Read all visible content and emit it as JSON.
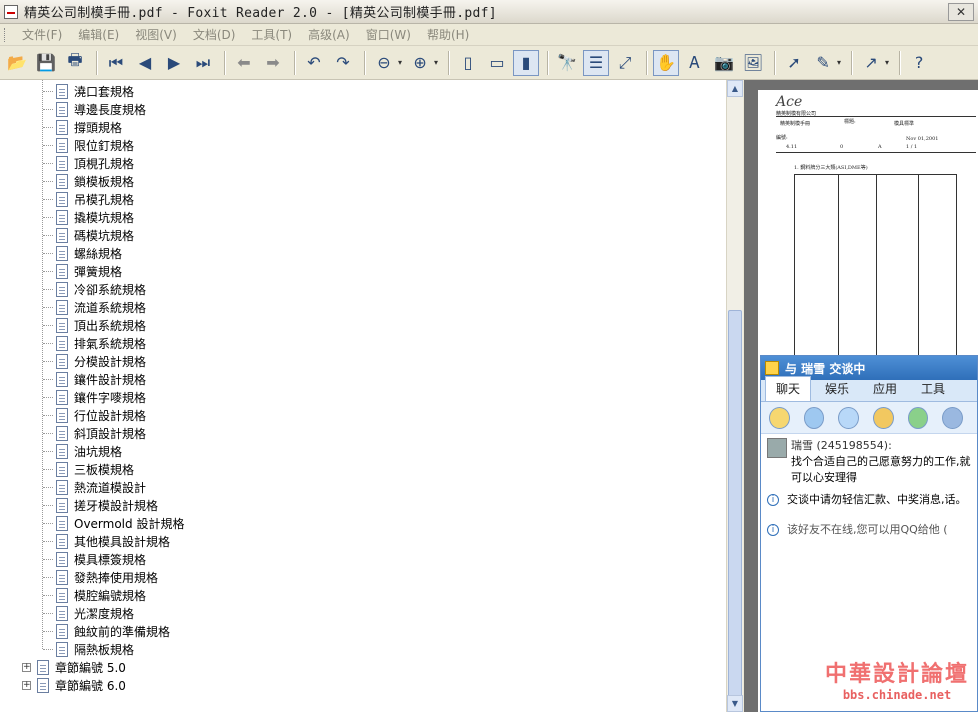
{
  "window": {
    "title": "精英公司制模手冊.pdf - Foxit Reader 2.0 - [精英公司制模手冊.pdf]",
    "close_glyph": "✕"
  },
  "menubar": {
    "items": [
      "文件(F)",
      "编辑(E)",
      "视图(V)",
      "文档(D)",
      "工具(T)",
      "高级(A)",
      "窗口(W)",
      "帮助(H)"
    ]
  },
  "toolbar": {
    "buttons": [
      {
        "name": "open-icon",
        "glyph": "📂"
      },
      {
        "name": "save-icon",
        "glyph": "💾"
      },
      {
        "name": "print-icon",
        "glyph": "🖶"
      },
      {
        "name": "first-page-icon",
        "glyph": "⏮"
      },
      {
        "name": "previous-page-icon",
        "glyph": "◀"
      },
      {
        "name": "next-page-icon",
        "glyph": "▶"
      },
      {
        "name": "last-page-icon",
        "glyph": "⏭"
      },
      {
        "name": "back-icon",
        "glyph": "⬅"
      },
      {
        "name": "forward-icon",
        "glyph": "➡"
      },
      {
        "name": "rotate-left-icon",
        "glyph": "↶"
      },
      {
        "name": "rotate-right-icon",
        "glyph": "↷"
      },
      {
        "name": "zoom-out-icon",
        "glyph": "⊖"
      },
      {
        "name": "zoom-in-icon",
        "glyph": "⊕"
      },
      {
        "name": "single-page-icon",
        "glyph": "▯"
      },
      {
        "name": "continuous-icon",
        "glyph": "▭"
      },
      {
        "name": "facing-icon",
        "glyph": "▮"
      },
      {
        "name": "find-icon",
        "glyph": "🔭"
      },
      {
        "name": "bookmarks-panel-icon",
        "glyph": "☰"
      },
      {
        "name": "full-screen-icon",
        "glyph": "⤢"
      },
      {
        "name": "hand-tool-icon",
        "glyph": "✋"
      },
      {
        "name": "text-select-icon",
        "glyph": "Ꭺ"
      },
      {
        "name": "snapshot-icon",
        "glyph": "📷"
      },
      {
        "name": "image-select-icon",
        "glyph": "🖼"
      },
      {
        "name": "pointer-icon",
        "glyph": "➚"
      },
      {
        "name": "highlight-icon",
        "glyph": "✎"
      },
      {
        "name": "arrow-tool-icon",
        "glyph": "↗"
      },
      {
        "name": "help-icon",
        "glyph": "?"
      }
    ]
  },
  "bookmarks": {
    "children": [
      "澆口套規格",
      "導邊長度規格",
      "撐頭規格",
      "限位釘規格",
      "頂梘孔規格",
      "鎖模板規格",
      "吊模孔規格",
      "撬模坑規格",
      "碼模坑規格",
      "螺絲規格",
      "彈簧規格",
      "冷卻系統規格",
      "流道系統規格",
      "頂出系統規格",
      "排氣系統規格",
      "分模設計規格",
      "鑲件設計規格",
      "鑲件字嘜規格",
      "行位設計規格",
      "斜頂設計規格",
      "油坑規格",
      "三板模規格",
      "熱流道模設計",
      "搓牙模設計規格",
      "Overmold 設計規格",
      "其他模具設計規格",
      "模具標簽規格",
      "發熱捧使用規格",
      "模腔編號規格",
      "光潔度規格",
      "蝕紋前的準備規格",
      "隔熱板規格"
    ],
    "chapters": [
      "章節編號 5.0",
      "章節編號 6.0"
    ],
    "expand_glyph": "+"
  },
  "page_preview": {
    "logo": "Ace",
    "company": "精英制模有限公司",
    "manual": "精英制模手冊",
    "header_fields": [
      "編號:",
      "標題:",
      "模具標準"
    ],
    "doc_row": [
      "4.11",
      "0",
      "A",
      "Nov 01,2001",
      "1 / 1"
    ],
    "section": "1. 鋼料牌分三大類(ASI,DME等)"
  },
  "chat": {
    "title": "与 瑞雪 交谈中",
    "tabs": [
      "聊天",
      "娱乐",
      "应用",
      "工具"
    ],
    "messages": [
      {
        "sender": "瑞雪 (245198554):",
        "text": "找个合适自己的己愿意努力的工作,就可以心安理得"
      },
      {
        "text": "交谈中请勿轻信汇款、中奖消息,话。"
      },
      {
        "text": "该好友不在线,您可以用QQ给他 ("
      }
    ]
  },
  "watermark": {
    "title": "中華設計論壇",
    "url": "bbs.chinade.net"
  }
}
